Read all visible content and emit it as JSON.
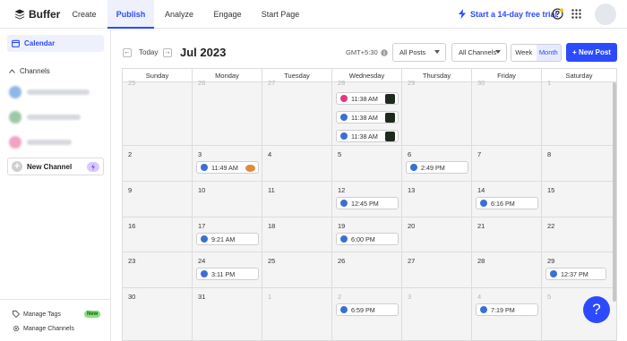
{
  "app": {
    "name": "Buffer"
  },
  "nav": {
    "tabs": [
      "Create",
      "Publish",
      "Analyze",
      "Engage",
      "Start Page"
    ],
    "active": "Publish",
    "trial_label": "Start a 14-day free trial"
  },
  "sidebar": {
    "calendar_label": "Calendar",
    "channels_label": "Channels",
    "new_channel_label": "New Channel",
    "manage_tags_label": "Manage Tags",
    "manage_tags_badge": "New",
    "manage_channels_label": "Manage Channels"
  },
  "toolbar": {
    "today_label": "Today",
    "month_label": "Jul 2023",
    "timezone": "GMT+5:30",
    "posts_filter": "All Posts",
    "channels_filter": "All Channels",
    "view_week": "Week",
    "view_month": "Month",
    "new_post_label": "+ New Post"
  },
  "calendar": {
    "days": [
      "Sunday",
      "Monday",
      "Tuesday",
      "Wednesday",
      "Thursday",
      "Friday",
      "Saturday"
    ],
    "weeks": [
      [
        {
          "day": "25",
          "dim": true,
          "posts": []
        },
        {
          "day": "26",
          "dim": true,
          "posts": []
        },
        {
          "day": "27",
          "dim": true,
          "posts": []
        },
        {
          "day": "28",
          "dim": true,
          "posts": [
            {
              "time": "11:38 AM",
              "icon": "pink",
              "thumb": "dark"
            },
            {
              "time": "11:38 AM",
              "icon": "blue",
              "thumb": "dark"
            },
            {
              "time": "11:38 AM",
              "icon": "blue",
              "thumb": "dark"
            }
          ]
        },
        {
          "day": "29",
          "dim": true,
          "posts": []
        },
        {
          "day": "30",
          "dim": true,
          "posts": []
        },
        {
          "day": "1",
          "dim": true,
          "posts": []
        }
      ],
      [
        {
          "day": "2",
          "posts": []
        },
        {
          "day": "3",
          "posts": [
            {
              "time": "11:49 AM",
              "icon": "blue",
              "thumb": "food"
            }
          ]
        },
        {
          "day": "4",
          "posts": []
        },
        {
          "day": "5",
          "posts": []
        },
        {
          "day": "6",
          "posts": [
            {
              "time": "2:49 PM",
              "icon": "blue"
            }
          ]
        },
        {
          "day": "7",
          "posts": []
        },
        {
          "day": "8",
          "posts": []
        }
      ],
      [
        {
          "day": "9",
          "posts": []
        },
        {
          "day": "10",
          "posts": []
        },
        {
          "day": "11",
          "posts": []
        },
        {
          "day": "12",
          "posts": [
            {
              "time": "12:45 PM",
              "icon": "blue"
            }
          ]
        },
        {
          "day": "13",
          "posts": []
        },
        {
          "day": "14",
          "posts": [
            {
              "time": "6:16 PM",
              "icon": "blue"
            }
          ]
        },
        {
          "day": "15",
          "posts": []
        }
      ],
      [
        {
          "day": "16",
          "posts": []
        },
        {
          "day": "17",
          "posts": [
            {
              "time": "9:21 AM",
              "icon": "blue"
            }
          ]
        },
        {
          "day": "18",
          "posts": []
        },
        {
          "day": "19",
          "posts": [
            {
              "time": "6:00 PM",
              "icon": "blue"
            }
          ]
        },
        {
          "day": "20",
          "posts": []
        },
        {
          "day": "21",
          "posts": []
        },
        {
          "day": "22",
          "posts": []
        }
      ],
      [
        {
          "day": "23",
          "posts": []
        },
        {
          "day": "24",
          "posts": [
            {
              "time": "3:11 PM",
              "icon": "blue"
            }
          ]
        },
        {
          "day": "25",
          "posts": []
        },
        {
          "day": "26",
          "posts": []
        },
        {
          "day": "27",
          "posts": []
        },
        {
          "day": "28",
          "posts": []
        },
        {
          "day": "29",
          "posts": [
            {
              "time": "12:37 PM",
              "icon": "blue"
            }
          ]
        }
      ],
      [
        {
          "day": "30",
          "posts": []
        },
        {
          "day": "31",
          "posts": []
        },
        {
          "day": "1",
          "dim": true,
          "posts": []
        },
        {
          "day": "2",
          "dim": true,
          "posts": [
            {
              "time": "6:59 PM",
              "icon": "blue"
            }
          ]
        },
        {
          "day": "3",
          "dim": true,
          "posts": []
        },
        {
          "day": "4",
          "dim": true,
          "posts": [
            {
              "time": "7:19 PM",
              "icon": "blue"
            }
          ]
        },
        {
          "day": "5",
          "dim": true,
          "posts": []
        }
      ]
    ]
  },
  "help_label": "?",
  "colors": {
    "accent": "#2c4bff",
    "instagram": "#e8347f",
    "facebook": "#3b6fd4"
  }
}
